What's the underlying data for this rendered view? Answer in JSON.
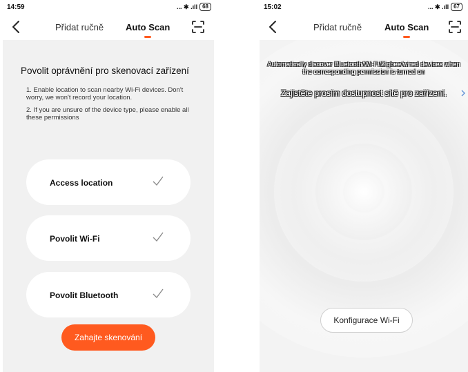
{
  "left": {
    "status": {
      "time": "14:59",
      "icons": "... ✱ .ıll ",
      "battery": "68"
    },
    "tabs": {
      "manual": "Přidat ručně",
      "auto": "Auto Scan"
    },
    "title": "Povolit oprávnění pro skenovací zařízení",
    "notes": [
      "1. Enable location to scan nearby Wi-Fi devices. Don't worry, we won't record your location.",
      "2. If you are unsure of the device type, please enable all these permissions"
    ],
    "permissions": [
      "Access location",
      "Povolit Wi-Fi",
      "Povolit Bluetooth"
    ],
    "start_button": "Zahajte skenování"
  },
  "right": {
    "status": {
      "time": "15:02",
      "icons": "... ✱ .ıll ",
      "battery": "67"
    },
    "tabs": {
      "manual": "Přidat ručně",
      "auto": "Auto Scan"
    },
    "auto_text": "Automatically discover Bluetooth/Wi-Fi/Zigbee/wired devices when the corresponding permission is turned on",
    "network_text": "Zajistěte prosím dostupnost sítě pro zařízení.",
    "wifi_button": "Konfigurace Wi-Fi"
  },
  "colors": {
    "accent": "#ff5a1f",
    "panel": "#f1f1f1"
  }
}
